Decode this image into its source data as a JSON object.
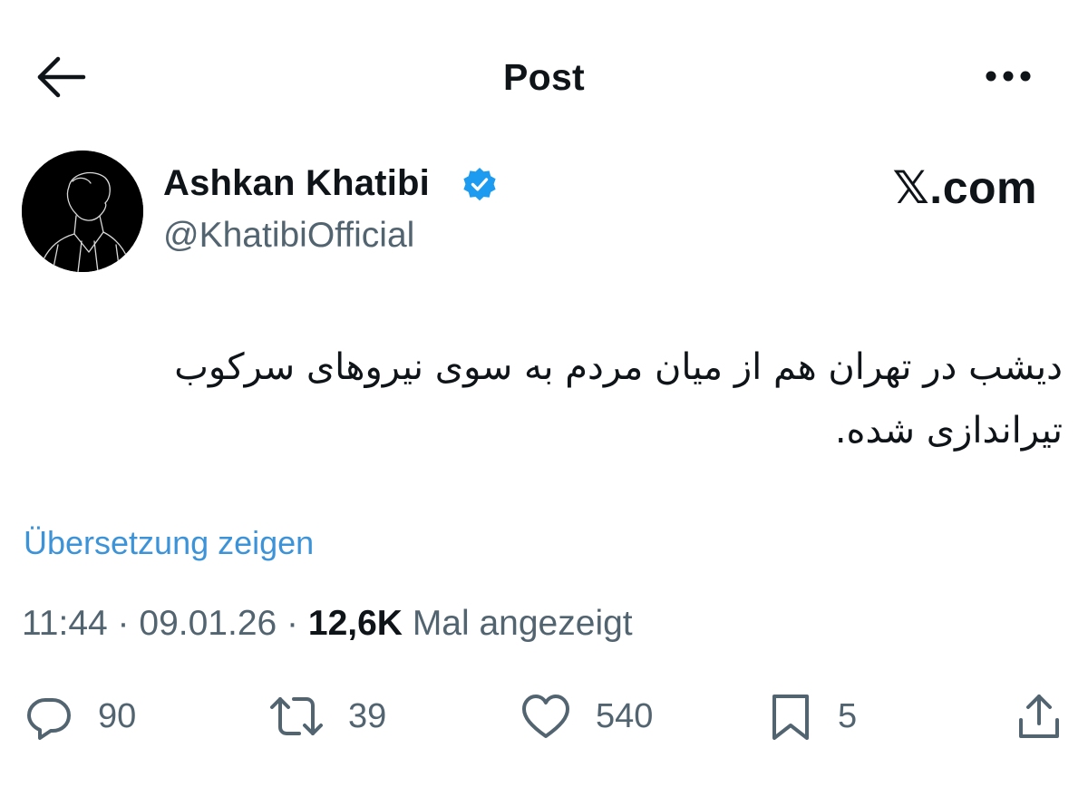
{
  "header": {
    "title": "Post",
    "back_icon": "arrow-left-icon",
    "more_icon": "more-horizontal-icon"
  },
  "author": {
    "name": "Ashkan Khatibi",
    "handle": "@KhatibiOfficial",
    "verified": true,
    "verified_color": "#1d9bf0"
  },
  "watermark": "𝕏.com",
  "post": {
    "text": "دیشب در تهران هم از میان مردم به سوی نیروهای سرکوب تیراندازی شده.",
    "translate_label": "Übersetzung zeigen"
  },
  "meta": {
    "time": "11:44",
    "separator": "·",
    "date": "09.01.26",
    "views_count": "12,6K",
    "views_label": "Mal angezeigt"
  },
  "actions": {
    "replies": "90",
    "reposts": "39",
    "likes": "540",
    "bookmarks": "5"
  },
  "colors": {
    "text": "#0f1419",
    "secondary": "#536471",
    "link": "#3d93d8",
    "verified": "#1d9bf0"
  }
}
